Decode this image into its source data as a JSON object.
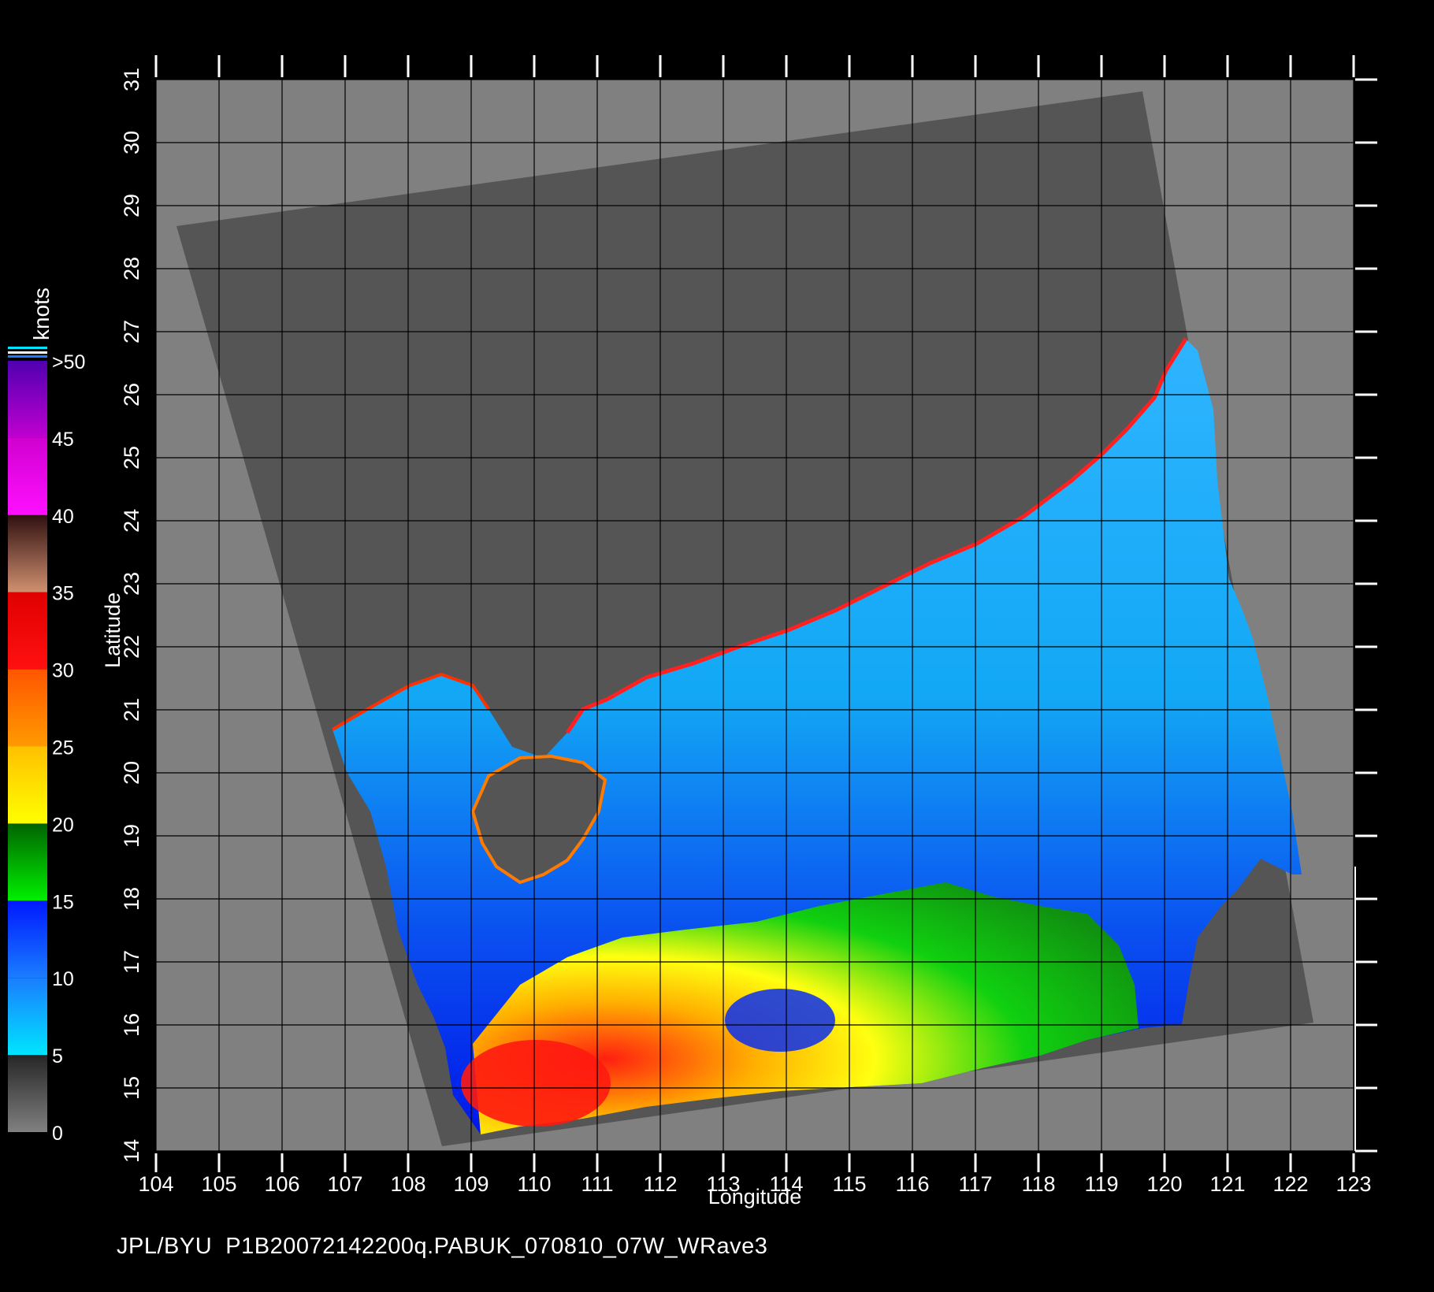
{
  "chart_data": {
    "type": "map",
    "xlabel": "Longitude",
    "ylabel": "Latitude",
    "xlim": [
      104,
      123
    ],
    "ylim": [
      14,
      31
    ],
    "x_ticks": [
      104,
      105,
      106,
      107,
      108,
      109,
      110,
      111,
      112,
      113,
      114,
      115,
      116,
      117,
      118,
      119,
      120,
      121,
      122,
      123
    ],
    "y_ticks": [
      14,
      15,
      16,
      17,
      18,
      19,
      20,
      21,
      22,
      23,
      24,
      25,
      26,
      27,
      28,
      29,
      30,
      31
    ],
    "grid": true,
    "colorbar": {
      "unit": "knots",
      "tick_labels": [
        {
          "value": 0,
          "label": "0"
        },
        {
          "value": 5,
          "label": "5"
        },
        {
          "value": 10,
          "label": "10"
        },
        {
          "value": 15,
          "label": "15"
        },
        {
          "value": 20,
          "label": "20"
        },
        {
          "value": 25,
          "label": "25"
        },
        {
          "value": 30,
          "label": "30"
        },
        {
          "value": 35,
          "label": "35"
        },
        {
          "value": 40,
          "label": "40"
        },
        {
          "value": 45,
          "label": "45"
        },
        {
          "value": 50,
          "label": ">50"
        }
      ],
      "bands": [
        {
          "from": 0,
          "to": 5,
          "colors": [
            "#808080",
            "#262626"
          ]
        },
        {
          "from": 5,
          "to": 10,
          "colors": [
            "#00e5ff",
            "#1a7dff"
          ]
        },
        {
          "from": 10,
          "to": 15,
          "colors": [
            "#1a7dff",
            "#0018ff"
          ]
        },
        {
          "from": 15,
          "to": 20,
          "colors": [
            "#00f000",
            "#006400"
          ]
        },
        {
          "from": 20,
          "to": 25,
          "colors": [
            "#ffff00",
            "#ffc000"
          ]
        },
        {
          "from": 25,
          "to": 30,
          "colors": [
            "#ff9a00",
            "#ff5500"
          ]
        },
        {
          "from": 30,
          "to": 35,
          "colors": [
            "#ff1010",
            "#e00000"
          ]
        },
        {
          "from": 35,
          "to": 40,
          "colors": [
            "#d09070",
            "#301010"
          ]
        },
        {
          "from": 40,
          "to": 45,
          "colors": [
            "#ff10ff",
            "#d000d0"
          ]
        },
        {
          "from": 45,
          "to": 50,
          "colors": [
            "#c000d0",
            "#5000b0"
          ]
        }
      ]
    },
    "colors": {
      "land_and_missing": "#808080",
      "swath_no_wind": "#555555",
      "grid_line": "#000000"
    }
  },
  "caption": "JPL/BYU  P1B20072142200q.PABUK_070810_07W_WRave3"
}
